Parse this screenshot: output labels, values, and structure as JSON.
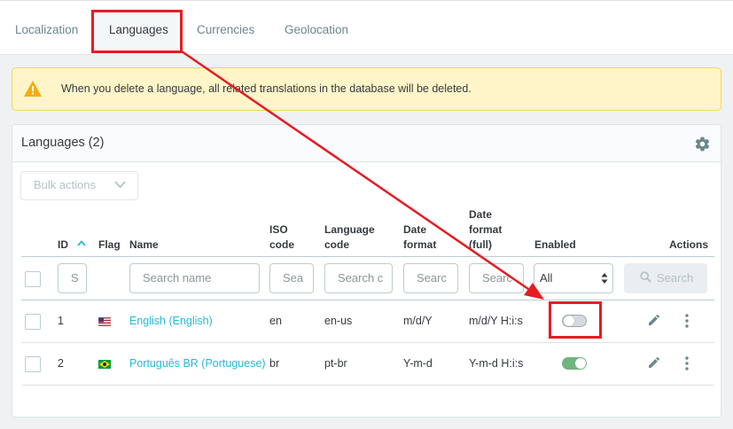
{
  "tabs": [
    {
      "label": "Localization"
    },
    {
      "label": "Languages"
    },
    {
      "label": "Currencies"
    },
    {
      "label": "Geolocation"
    }
  ],
  "alert": {
    "text": "When you delete a language, all related translations in the database will be deleted."
  },
  "card": {
    "title": "Languages (2)"
  },
  "bulk_actions": {
    "label": "Bulk actions"
  },
  "columns": {
    "id": "ID",
    "flag": "Flag",
    "name": "Name",
    "iso_code": [
      "ISO",
      "code"
    ],
    "language_code": [
      "Language",
      "code"
    ],
    "date_format": [
      "Date",
      "format"
    ],
    "date_format_full": [
      "Date",
      "format",
      "(full)"
    ],
    "enabled": "Enabled",
    "actions": "Actions"
  },
  "filters": {
    "id": "S",
    "name": "Search name",
    "iso_code": "Sea",
    "language_code": "Search c",
    "date_format": "Searc",
    "date_format_full": "Searc",
    "enabled_selected": "All",
    "search_button": "Search"
  },
  "rows": [
    {
      "id": "1",
      "name": "English (English)",
      "iso_code": "en",
      "language_code": "en-us",
      "date_format": "m/d/Y",
      "date_format_full": "m/d/Y H:i:s",
      "enabled": false,
      "flag": "us-flag"
    },
    {
      "id": "2",
      "name": "Português BR (Portuguese)",
      "iso_code": "br",
      "language_code": "pt-br",
      "date_format": "Y-m-d",
      "date_format_full": "Y-m-d H:i:s",
      "enabled": true,
      "flag": "br-flag"
    }
  ],
  "colors": {
    "accent": "#25b9d7",
    "toggle_on": "#70b580",
    "annotation": "#e51c23",
    "alert_bg": "#fff5c9"
  },
  "icons": [
    "warning-icon",
    "gear-icon",
    "chevron-down-icon",
    "sort-up-icon",
    "search-icon",
    "pencil-icon",
    "kebab-icon"
  ]
}
